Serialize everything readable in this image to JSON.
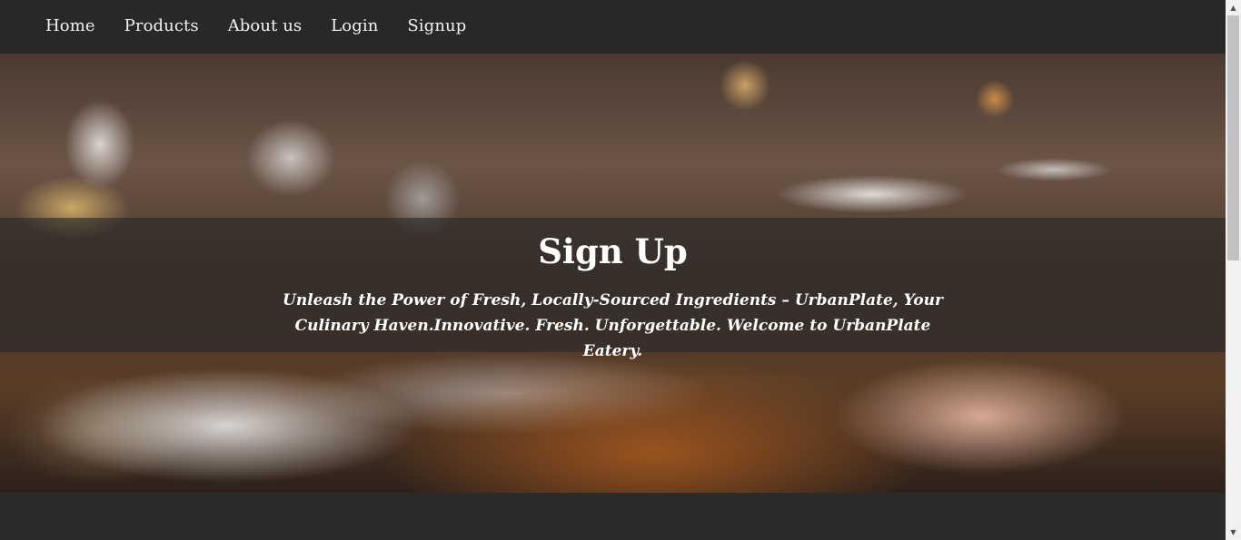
{
  "nav": {
    "items": [
      {
        "label": "Home"
      },
      {
        "label": "Products"
      },
      {
        "label": "About us"
      },
      {
        "label": "Login"
      },
      {
        "label": "Signup"
      }
    ]
  },
  "hero": {
    "title": "Sign Up",
    "subtitle": "Unleash the Power of Fresh, Locally-Sourced Ingredients – UrbanPlate, Your Culinary Haven.Innovative. Fresh. Unforgettable. Welcome to UrbanPlate Eatery."
  },
  "scrollbar": {
    "up_icon": "triangle-up",
    "down_icon": "triangle-down"
  },
  "colors": {
    "nav_background": "#282828",
    "page_background": "#2b2b2b",
    "text": "#ffffff"
  }
}
